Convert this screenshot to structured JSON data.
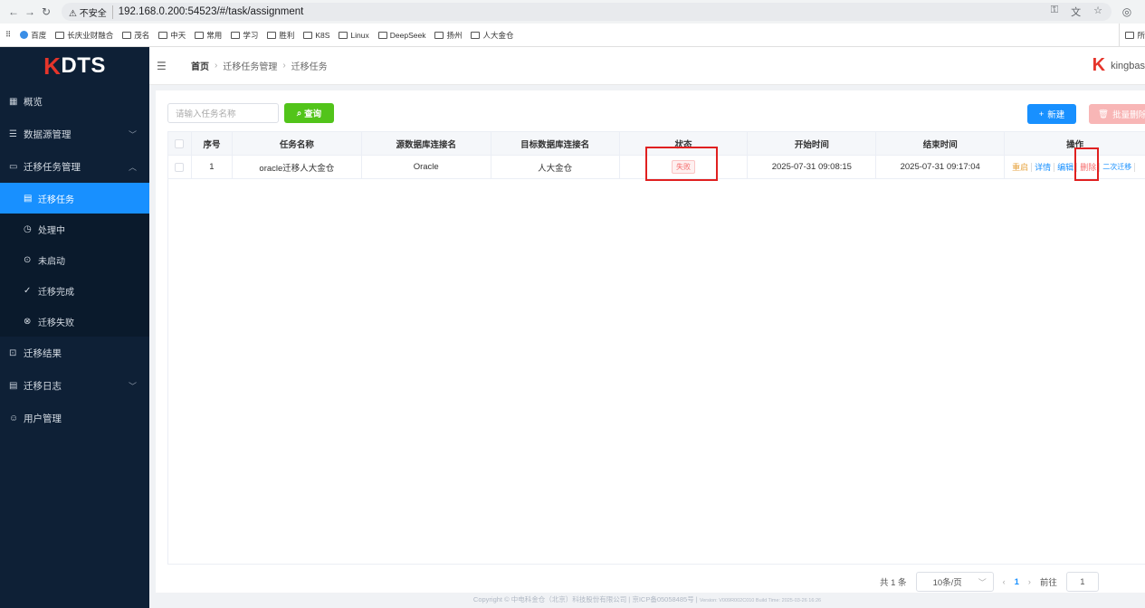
{
  "browser": {
    "insecure_label": "不安全",
    "url": "192.168.0.200:54523/#/task/assignment",
    "bookmarks": [
      "百度",
      "长庆业财融合",
      "茂名",
      "中天",
      "常用",
      "学习",
      "胜利",
      "K8S",
      "Linux",
      "DeepSeek",
      "扬州",
      "人大金仓"
    ],
    "bookmarks_right": "所"
  },
  "sidebar": {
    "logo_k": "K",
    "logo_rest": "DTS",
    "items": [
      {
        "label": "概览"
      },
      {
        "label": "数据源管理"
      },
      {
        "label": "迁移任务管理"
      },
      {
        "label": "迁移结果"
      },
      {
        "label": "迁移日志"
      },
      {
        "label": "用户管理"
      }
    ],
    "sub_items": [
      {
        "label": "迁移任务"
      },
      {
        "label": "处理中"
      },
      {
        "label": "未启动"
      },
      {
        "label": "迁移完成"
      },
      {
        "label": "迁移失败"
      }
    ]
  },
  "header": {
    "breadcrumb": [
      "首页",
      "迁移任务管理",
      "迁移任务"
    ],
    "brand": "kingbas"
  },
  "toolbar": {
    "search_placeholder": "请输入任务名称",
    "query_label": "查询",
    "new_label": "新建",
    "bulk_delete_label": "批量删除"
  },
  "table": {
    "columns": [
      "序号",
      "任务名称",
      "源数据库连接名",
      "目标数据库连接名",
      "状态",
      "开始时间",
      "结束时间",
      "操作"
    ],
    "rows": [
      {
        "index": "1",
        "name": "oracle迁移人大金仓",
        "source": "Oracle",
        "target": "人大金仓",
        "status": "失败",
        "start": "2025-07-31 09:08:15",
        "end": "2025-07-31 09:17:04",
        "actions": [
          "重启",
          "详情",
          "编辑",
          "删除",
          "二次迁移"
        ]
      }
    ]
  },
  "pagination": {
    "total": "共 1 条",
    "page_size": "10条/页",
    "current_page": "1",
    "goto_label": "前往",
    "goto_value": "1"
  },
  "footer": {
    "copyright": "Copyright © 中电科金仓（北京）科技股份有限公司 | 京ICP备05058485号 |",
    "version": "Version: V009R002C010 Build Time: 2025-03-26 16:26"
  },
  "colors": {
    "sidebar_bg": "#0e2036",
    "active": "#1890ff",
    "query": "#52c41a",
    "danger": "#f56c6c",
    "highlight_box": "#e02020"
  }
}
